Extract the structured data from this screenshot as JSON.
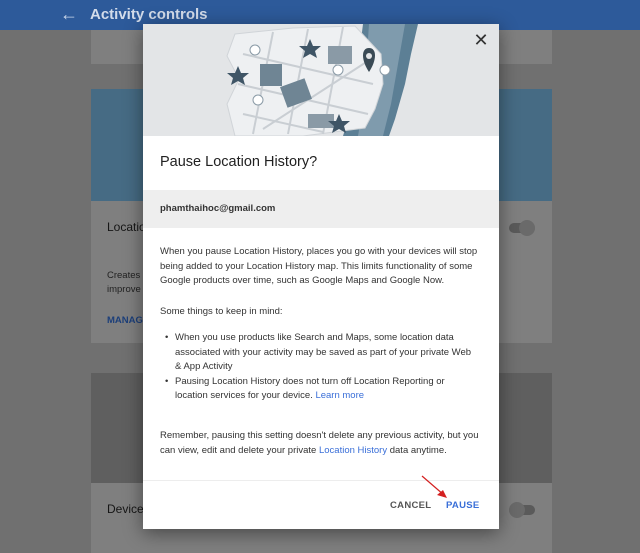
{
  "appbar": {
    "back_icon": "arrow-back-icon",
    "title": "Activity controls"
  },
  "background": {
    "location_card": {
      "row_label": "Locatio",
      "description_lines": [
        "Creates",
        "improve"
      ],
      "manage_link": "MANAG"
    },
    "device_card": {
      "row_label": "Device"
    }
  },
  "dialog": {
    "close_icon": "close-icon",
    "title": "Pause Location History?",
    "account": "phamthaihoc@gmail.com",
    "paragraph1": "When you pause Location History, places you go with your devices will stop being added to your Location History map. This limits functionality of some Google products over time, such as Google Maps and Google Now.",
    "paragraph2": "Some things to keep in mind:",
    "bullets": {
      "b1": "When you use products like Search and Maps, some location data associated with your activity may be saved as part of your private Web & App Activity",
      "b2_text": "Pausing Location History does not turn off Location Reporting or location services for your device. ",
      "b2_link": "Learn more"
    },
    "paragraph3_prefix": "Remember, pausing this setting doesn't delete any previous activity, but you can view, edit and delete your private ",
    "paragraph3_link": "Location History",
    "paragraph3_suffix": " data anytime.",
    "cancel_label": "CANCEL",
    "pause_label": "PAUSE"
  },
  "colors": {
    "appbar": "#3c78d8",
    "link": "#3a6fd8",
    "hero_bg": "#e3e5e7"
  }
}
